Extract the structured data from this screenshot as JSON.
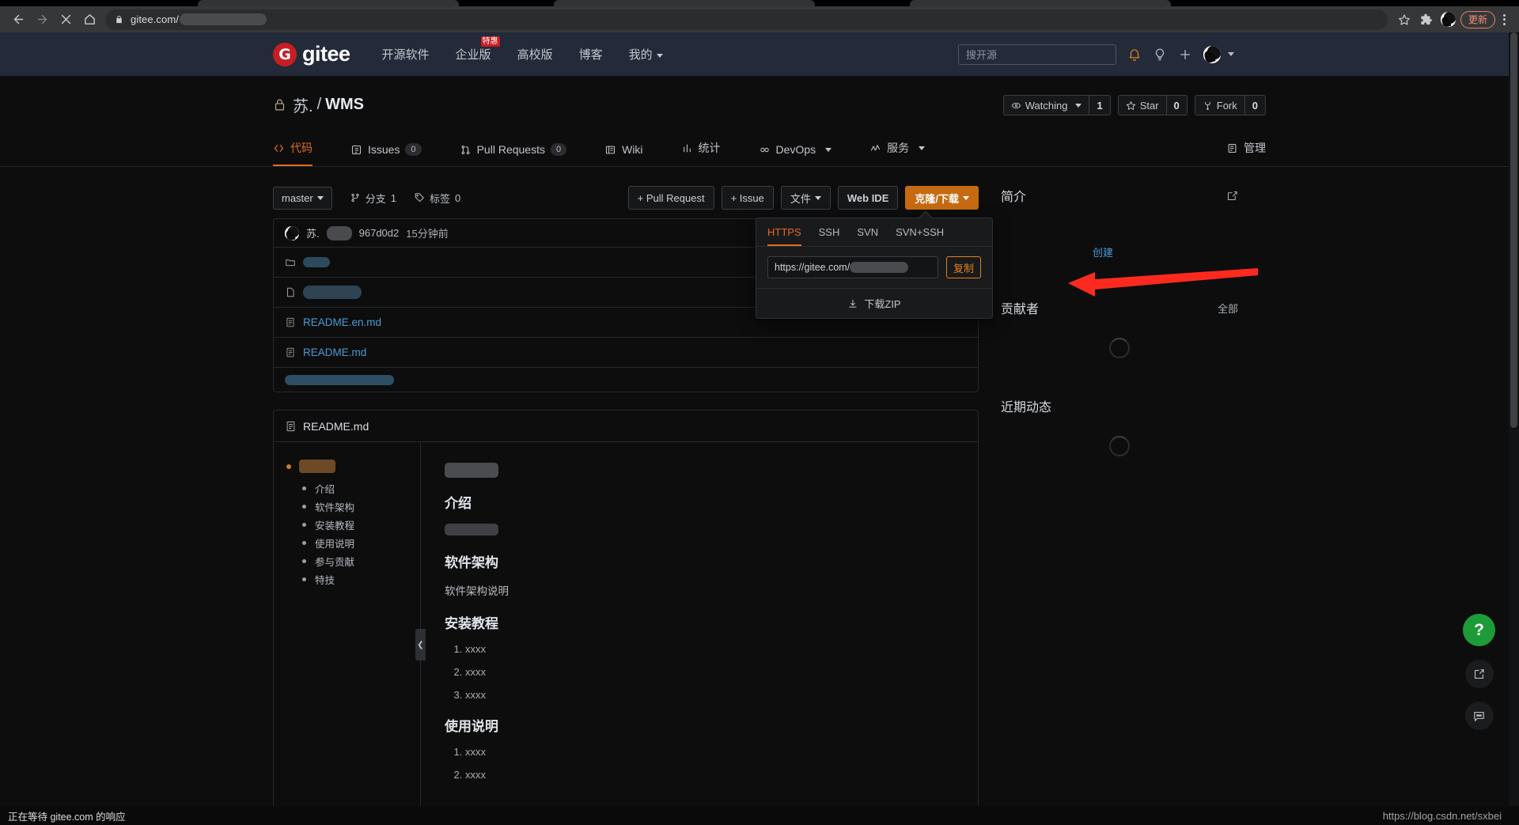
{
  "browser": {
    "url_prefix": "gitee.com/",
    "back_icon": "back-arrow-icon",
    "forward_icon": "forward-arrow-icon",
    "stop_icon": "stop-loading-icon",
    "home_icon": "home-icon",
    "lock_icon": "lock-icon",
    "bookmark_icon": "star-outline-icon",
    "extensions_icon": "puzzle-piece-icon",
    "update_label": "更新",
    "menu_icon": "three-dot-menu-icon"
  },
  "gitee_nav": {
    "logo_letter": "G",
    "logo_text": "gitee",
    "items": [
      {
        "label": "开源软件",
        "badge": null,
        "caret": false
      },
      {
        "label": "企业版",
        "badge": "特惠",
        "caret": false
      },
      {
        "label": "高校版",
        "badge": null,
        "caret": false
      },
      {
        "label": "博客",
        "badge": null,
        "caret": false
      },
      {
        "label": "我的",
        "badge": null,
        "caret": true
      }
    ],
    "search_placeholder": "搜开源",
    "icons": [
      "bell-icon",
      "lightbulb-icon",
      "plus-icon",
      "avatar"
    ]
  },
  "repo": {
    "visibility_icon": "lock-icon",
    "owner": "苏.",
    "separator": "/",
    "name": "WMS",
    "watching_label": "Watching",
    "watching_count": "1",
    "star_label": "Star",
    "star_count": "0",
    "fork_label": "Fork",
    "fork_count": "0"
  },
  "repo_tabs": [
    {
      "label": "代码",
      "icon": "code-icon",
      "count": null,
      "caret": false,
      "active": true
    },
    {
      "label": "Issues",
      "icon": "issue-icon",
      "count": "0",
      "caret": false,
      "active": false
    },
    {
      "label": "Pull Requests",
      "icon": "pull-request-icon",
      "count": "0",
      "caret": false,
      "active": false
    },
    {
      "label": "Wiki",
      "icon": "wiki-icon",
      "count": null,
      "caret": false,
      "active": false
    },
    {
      "label": "统计",
      "icon": "chart-icon",
      "count": null,
      "caret": false,
      "active": false
    },
    {
      "label": "DevOps",
      "icon": "infinity-icon",
      "count": null,
      "caret": true,
      "active": false
    },
    {
      "label": "服务",
      "icon": "service-icon",
      "count": null,
      "caret": true,
      "active": false
    },
    {
      "label": "管理",
      "icon": "manage-icon",
      "count": null,
      "caret": false,
      "active": false
    }
  ],
  "code_toolbar": {
    "branch": "master",
    "branches_label": "分支",
    "branches_count": "1",
    "tags_label": "标签",
    "tags_count": "0",
    "pull_request_btn": "+ Pull Request",
    "issue_btn": "+ Issue",
    "files_btn": "文件",
    "web_ide_btn": "Web IDE",
    "clone_btn": "克隆/下载"
  },
  "clone_popup": {
    "tabs": [
      "HTTPS",
      "SSH",
      "SVN",
      "SVN+SSH"
    ],
    "active_tab": "HTTPS",
    "url_value": "https://gitee.com/",
    "copy_label": "复制",
    "download_zip_label": "下载ZIP",
    "download_icon": "download-icon"
  },
  "commit": {
    "author": "苏.",
    "sha": "967d0d2",
    "time": "15分钟前"
  },
  "files": [
    {
      "name": "",
      "type": "folder",
      "redacted": true,
      "redact_width": 34
    },
    {
      "name": "",
      "type": "file",
      "redacted": true,
      "redact_width": 74
    },
    {
      "name": "README.en.md",
      "type": "file",
      "redacted": false
    },
    {
      "name": "README.md",
      "type": "file",
      "redacted": false
    }
  ],
  "readme": {
    "title": "README.md",
    "title_icon": "file-text-icon",
    "toc": [
      "介绍",
      "软件架构",
      "安装教程",
      "使用说明",
      "参与贡献",
      "特技"
    ],
    "sections": [
      {
        "heading": "介绍",
        "paragraph": null,
        "list": []
      },
      {
        "heading": "软件架构",
        "paragraph": "软件架构说明",
        "list": []
      },
      {
        "heading": "安装教程",
        "paragraph": null,
        "list": [
          "xxxx",
          "xxxx",
          "xxxx"
        ]
      },
      {
        "heading": "使用说明",
        "paragraph": null,
        "list": [
          "xxxx",
          "xxxx"
        ]
      }
    ]
  },
  "sidebar": {
    "intro_title": "简介",
    "edit_icon": "edit-pencil-icon",
    "create_link": "创建",
    "contributors_title": "贡献者",
    "contributors_all": "全部",
    "activity_title": "近期动态"
  },
  "floating": {
    "help_label": "?",
    "external_icon": "external-link-icon",
    "feedback_icon": "chat-bubble-icon"
  },
  "statusbar": {
    "loading_text": "正在等待 gitee.com 的响应",
    "watermark": "https://blog.csdn.net/sxbei"
  }
}
